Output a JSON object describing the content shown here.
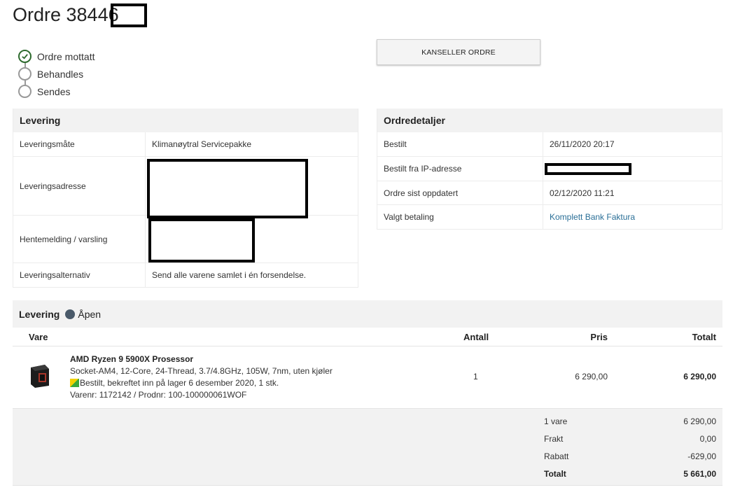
{
  "page": {
    "title": "Ordre 38446"
  },
  "status_steps": [
    {
      "label": "Ordre mottatt",
      "done": true
    },
    {
      "label": "Behandles",
      "done": false
    },
    {
      "label": "Sendes",
      "done": false
    }
  ],
  "actions": {
    "cancel_label": "KANSELLER ORDRE"
  },
  "delivery_panel": {
    "title": "Levering",
    "rows": [
      {
        "key": "Leveringsmåte",
        "value": "Klimanøytral Servicepakke"
      },
      {
        "key": "Leveringsadresse",
        "value": ""
      },
      {
        "key": "Hentemelding / varsling",
        "value": ""
      },
      {
        "key": "Leveringsalternativ",
        "value": "Send alle varene samlet i én forsendelse."
      }
    ]
  },
  "order_details_panel": {
    "title": "Ordredetaljer",
    "rows": [
      {
        "key": "Bestilt",
        "value": "26/11/2020 20:17"
      },
      {
        "key": "Bestilt fra IP-adresse",
        "value": ""
      },
      {
        "key": "Ordre sist oppdatert",
        "value": "02/12/2020 11:21"
      },
      {
        "key": "Valgt betaling",
        "value": "Komplett Bank Faktura"
      }
    ]
  },
  "shipment": {
    "title": "Levering",
    "status": "Åpen",
    "columns": {
      "item": "Vare",
      "qty": "Antall",
      "price": "Pris",
      "total": "Totalt"
    },
    "items": [
      {
        "name": "AMD Ryzen 9 5900X Prosessor",
        "specs": "Socket-AM4, 12-Core, 24-Thread, 3.7/4.8GHz, 105W, 7nm, uten kjøler",
        "stock": "Bestilt, bekreftet inn på lager 6 desember 2020, 1 stk.",
        "ids": "Varenr: 1172142 / Prodnr: 100-100000061WOF",
        "qty": "1",
        "price": "6 290,00",
        "total": "6 290,00"
      }
    ],
    "summary": [
      {
        "label": "1 vare",
        "value": "6 290,00"
      },
      {
        "label": "Frakt",
        "value": "0,00"
      },
      {
        "label": "Rabatt",
        "value": "-629,00"
      },
      {
        "label": "Totalt",
        "value": "5 661,00"
      }
    ]
  },
  "colors": {
    "accent_green": "#2e6b2e",
    "link_blue": "#2a6f97",
    "status_dot": "#4a5a6a"
  }
}
